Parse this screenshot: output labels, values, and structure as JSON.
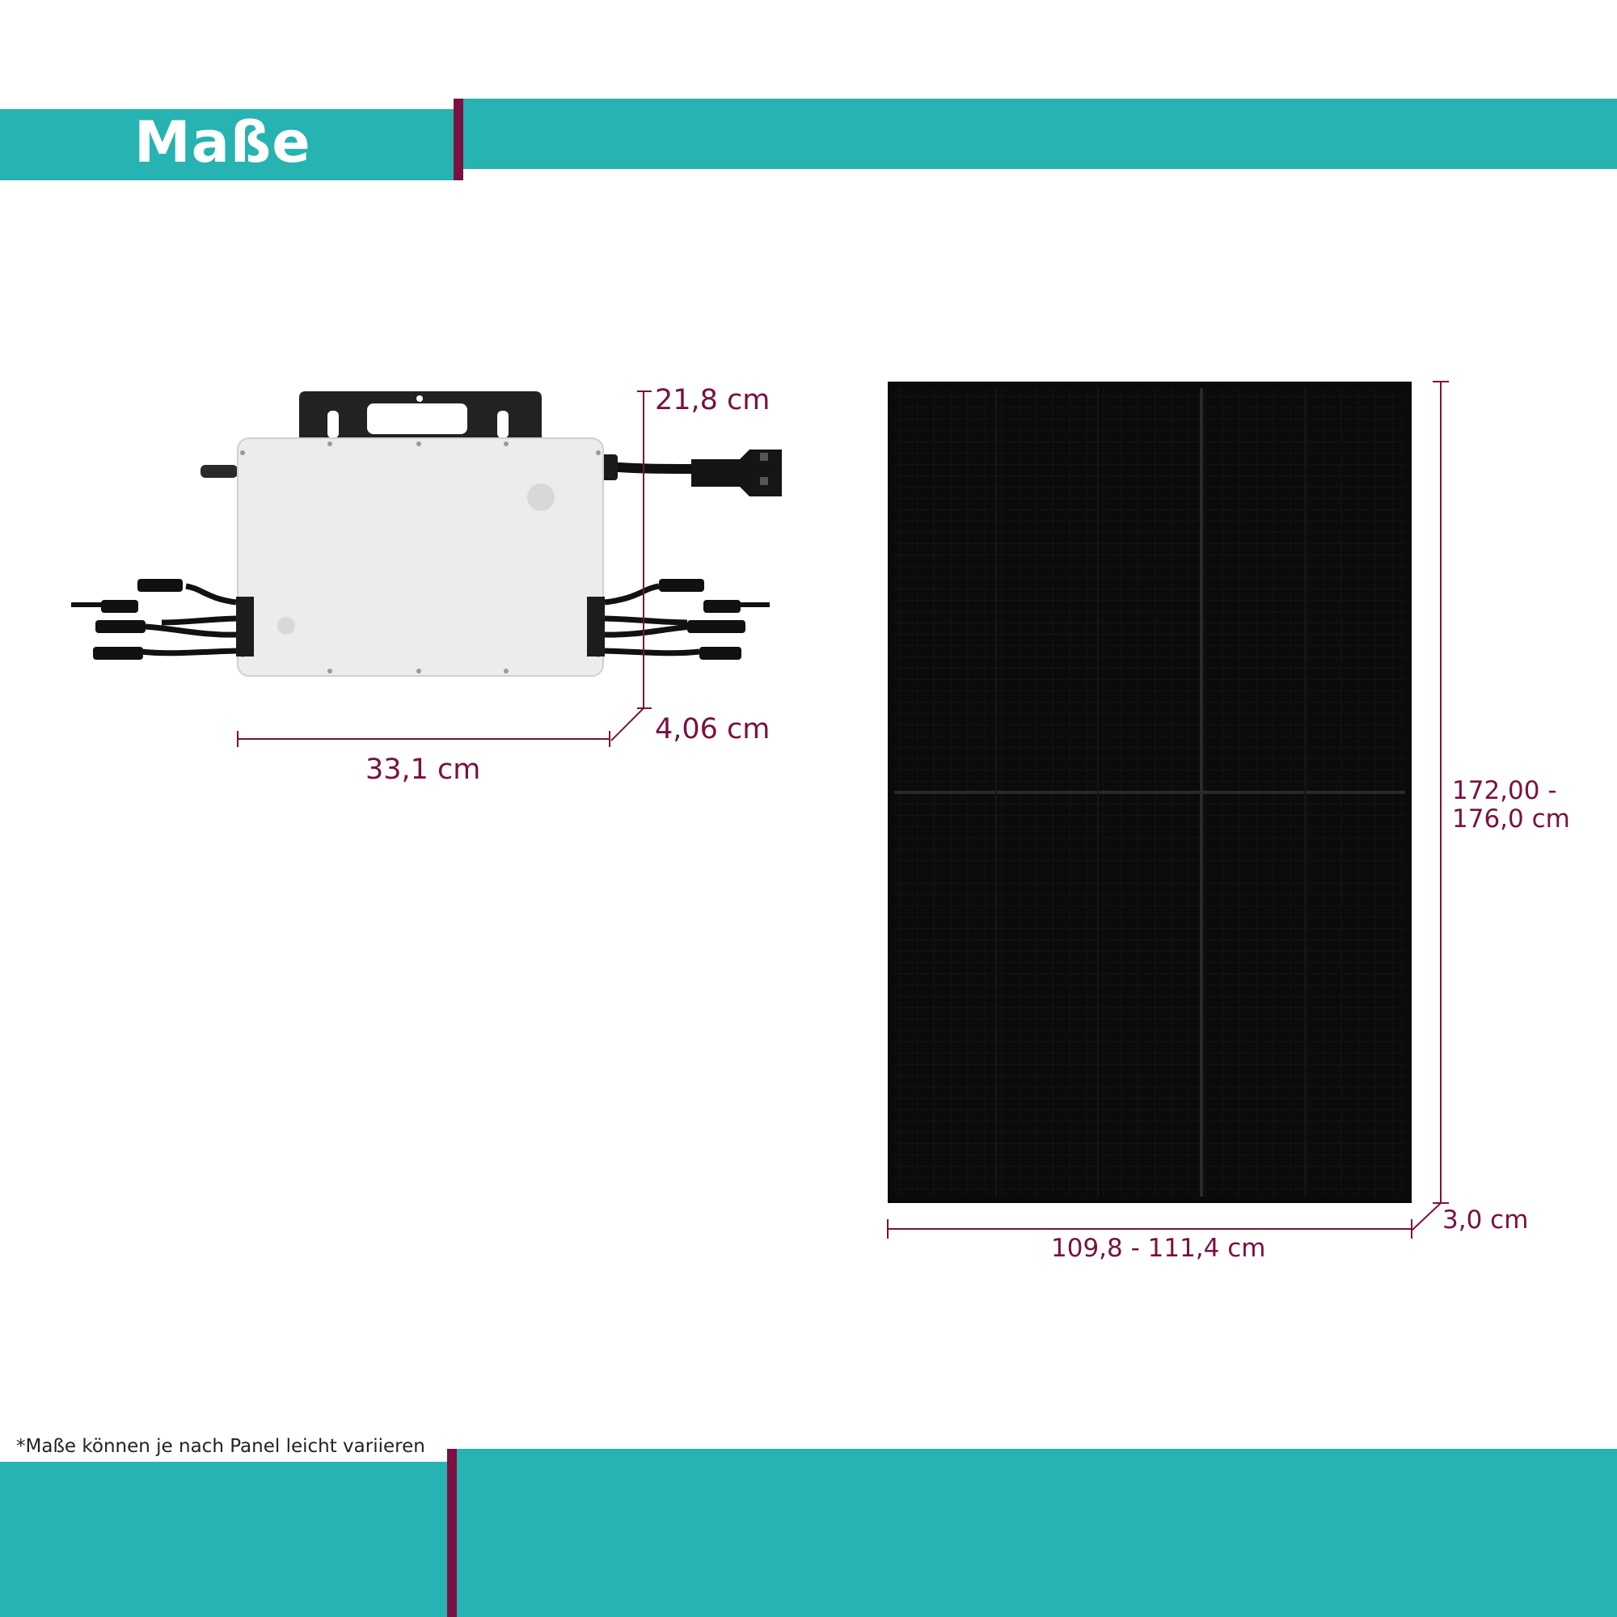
{
  "header": {
    "title": "Maße"
  },
  "inverter": {
    "height_label": "21,8 cm",
    "depth_label": "4,06 cm",
    "width_label": "33,1 cm"
  },
  "panel": {
    "height_label_line1": "172,00 -",
    "height_label_line2": "176,0 cm",
    "depth_label": "3,0 cm",
    "width_label": "109,8 - 111,4 cm"
  },
  "footer": {
    "note": "*Maße können je nach Panel leicht variieren"
  },
  "colors": {
    "teal": "#26b3b1",
    "accent": "#7a1140",
    "panel": "#0a0a0a"
  }
}
